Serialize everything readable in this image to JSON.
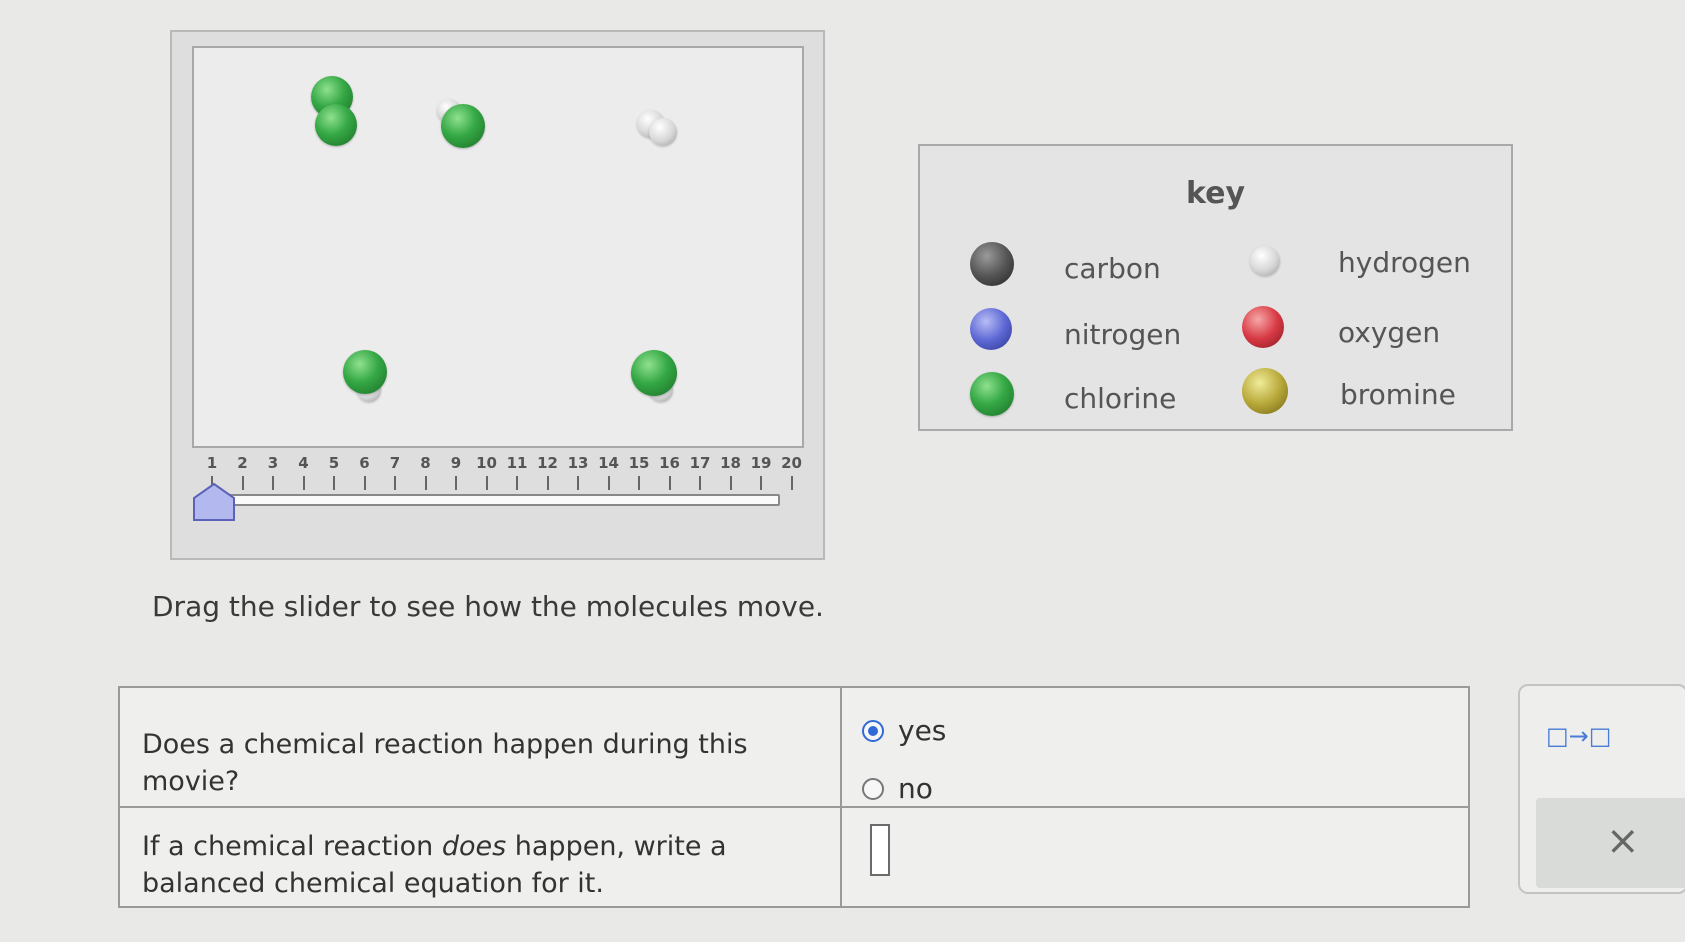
{
  "simulation": {
    "slider": {
      "ticks": [
        "1",
        "2",
        "3",
        "4",
        "5",
        "6",
        "7",
        "8",
        "9",
        "10",
        "11",
        "12",
        "13",
        "14",
        "15",
        "16",
        "17",
        "18",
        "19",
        "20"
      ],
      "current_frame": 1
    },
    "caption": "Drag the slider to see how the molecules move."
  },
  "key": {
    "title": "key",
    "items": [
      {
        "label": "carbon",
        "color": "#4a4a4a"
      },
      {
        "label": "hydrogen",
        "color": "#d8d8d8"
      },
      {
        "label": "nitrogen",
        "color": "#5d68d4"
      },
      {
        "label": "oxygen",
        "color": "#d83a44"
      },
      {
        "label": "chlorine",
        "color": "#35a845"
      },
      {
        "label": "bromine",
        "color": "#b9a93a"
      }
    ]
  },
  "questions": {
    "q1": {
      "text": "Does a chemical reaction happen during this movie?",
      "options": [
        "yes",
        "no"
      ],
      "selected": "yes"
    },
    "q2": {
      "text_before": "If a chemical reaction ",
      "text_em": "does",
      "text_after": " happen, write a balanced chemical equation for it."
    }
  },
  "tools": {
    "arrow_tool": "□→□",
    "clear_icon": "×"
  },
  "colors": {
    "selected_radio": "#2f6ad6",
    "chlorine": "#35a845",
    "hydrogen": "#d8d8d8"
  }
}
